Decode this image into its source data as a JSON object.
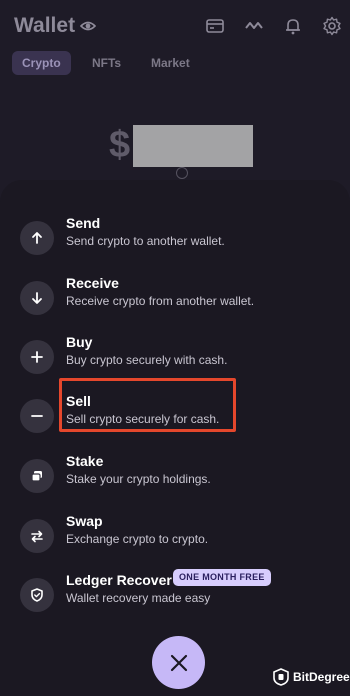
{
  "header": {
    "title": "Wallet",
    "icons": [
      "eye-icon",
      "card-icon",
      "activity-icon",
      "bell-icon",
      "gear-icon"
    ]
  },
  "tabs": [
    {
      "label": "Crypto",
      "active": true
    },
    {
      "label": "NFTs",
      "active": false
    },
    {
      "label": "Market",
      "active": false
    }
  ],
  "balance": {
    "currency_symbol": "$"
  },
  "actions": [
    {
      "title": "Send",
      "description": "Send crypto to another wallet.",
      "icon": "arrow-up-icon"
    },
    {
      "title": "Receive",
      "description": "Receive crypto from another wallet.",
      "icon": "arrow-down-icon"
    },
    {
      "title": "Buy",
      "description": "Buy crypto securely with cash.",
      "icon": "plus-icon"
    },
    {
      "title": "Sell",
      "description": "Sell crypto securely for cash.",
      "icon": "minus-icon",
      "highlighted": true
    },
    {
      "title": "Stake",
      "description": "Stake your crypto holdings.",
      "icon": "stack-icon"
    },
    {
      "title": "Swap",
      "description": "Exchange crypto to crypto.",
      "icon": "swap-icon"
    },
    {
      "title": "Ledger Recover",
      "description": "Wallet recovery made easy",
      "icon": "shield-icon",
      "badge": "ONE MONTH FREE"
    }
  ],
  "close_icon": "close-icon",
  "watermark": {
    "text": "BitDegree"
  },
  "colors": {
    "highlight": "#e5472c",
    "accent": "#c6b8f7",
    "badge_bg": "#d7cdfd"
  }
}
